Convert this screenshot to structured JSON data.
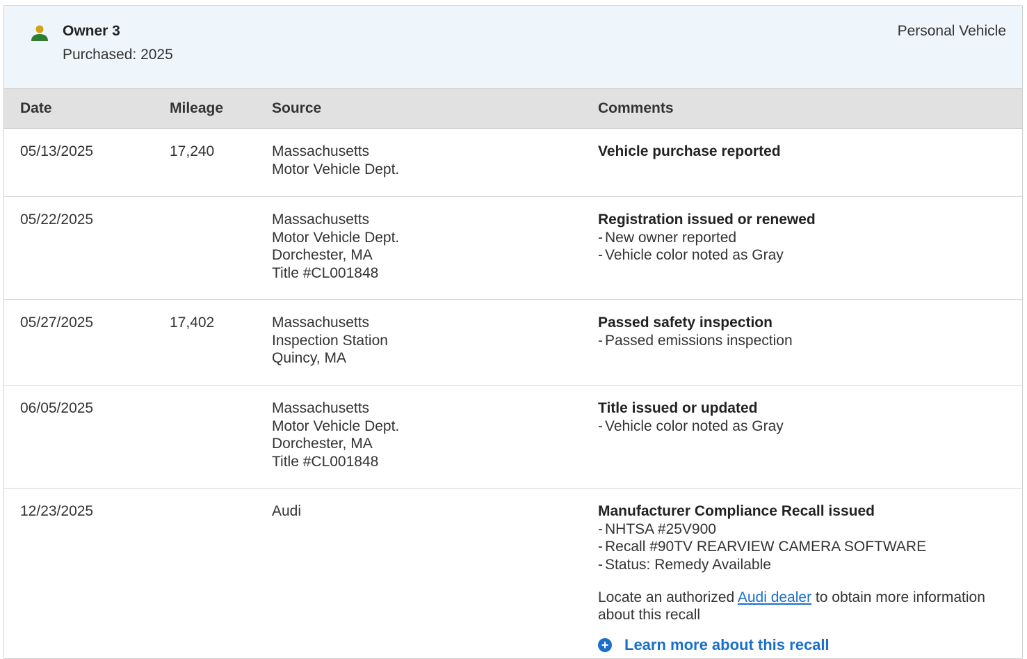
{
  "owner": {
    "name": "Owner 3",
    "purchased": "Purchased: 2025",
    "type": "Personal Vehicle",
    "icon": "person-icon",
    "icon_colors": {
      "head": "#d4a015",
      "body": "#2e7d32"
    }
  },
  "table": {
    "headers": {
      "date": "Date",
      "mileage": "Mileage",
      "source": "Source",
      "comments": "Comments"
    },
    "rows": [
      {
        "date": "05/13/2025",
        "mileage": "17,240",
        "source": [
          "Massachusetts",
          "Motor Vehicle Dept."
        ],
        "comment_title": "Vehicle purchase reported",
        "bullets": []
      },
      {
        "date": "05/22/2025",
        "mileage": "",
        "source": [
          "Massachusetts",
          "Motor Vehicle Dept.",
          "Dorchester, MA",
          "Title #CL001848"
        ],
        "comment_title": "Registration issued or renewed",
        "bullets": [
          "New owner reported",
          "Vehicle color noted as Gray"
        ]
      },
      {
        "date": "05/27/2025",
        "mileage": "17,402",
        "source": [
          "Massachusetts",
          "Inspection Station",
          "Quincy, MA"
        ],
        "comment_title": "Passed safety inspection",
        "bullets": [
          "Passed emissions inspection"
        ]
      },
      {
        "date": "06/05/2025",
        "mileage": "",
        "source": [
          "Massachusetts",
          "Motor Vehicle Dept.",
          "Dorchester, MA",
          "Title #CL001848"
        ],
        "comment_title": "Title issued or updated",
        "bullets": [
          "Vehicle color noted as Gray"
        ]
      },
      {
        "date": "12/23/2025",
        "mileage": "",
        "source": [
          "Audi"
        ],
        "comment_title": "Manufacturer Compliance Recall issued",
        "bullets": [
          "NHTSA #25V900",
          "Recall #90TV REARVIEW CAMERA SOFTWARE",
          "Status: Remedy Available"
        ]
      }
    ],
    "recall": {
      "text_before": "Locate an authorized ",
      "link_text": "Audi dealer",
      "text_after": " to obtain more information about this recall",
      "learn_more": "Learn more about this recall"
    }
  },
  "colors": {
    "link": "#1a6fc9",
    "header_bg": "#eef5fb",
    "thead_bg": "#e1e1e1"
  }
}
